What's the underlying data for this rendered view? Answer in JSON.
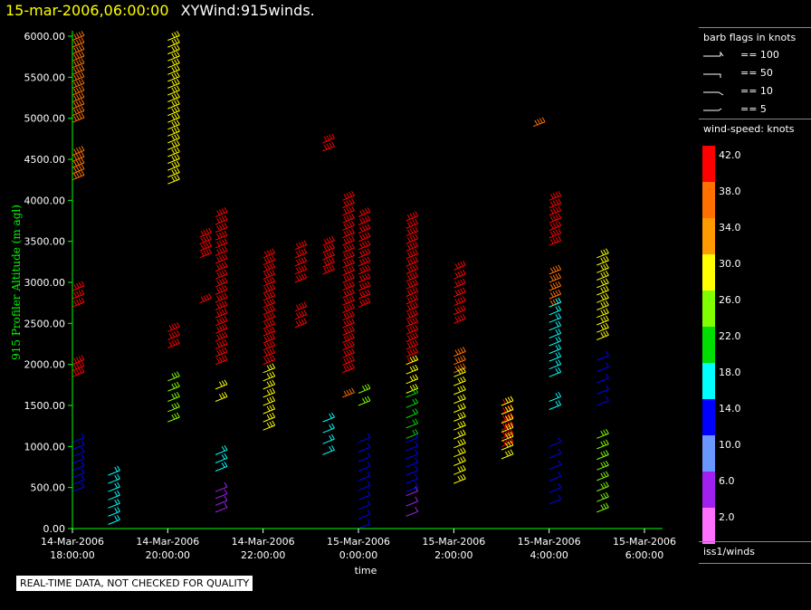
{
  "header": {
    "date": "15-mar-2006,06:00:00",
    "title": "XYWind:915winds."
  },
  "legend": {
    "barb_title": "barb flags in knots",
    "barb_items": [
      "== 100",
      "== 50",
      "== 10",
      "== 5"
    ],
    "speed_title": "wind-speed: knots",
    "scale_labels": [
      "42.0",
      "38.0",
      "34.0",
      "30.0",
      "26.0",
      "22.0",
      "18.0",
      "14.0",
      "10.0",
      "6.0",
      "2.0"
    ],
    "scale_colors": [
      "#ff0000",
      "#ff7000",
      "#ff9a00",
      "#ffff00",
      "#80ff00",
      "#00dd00",
      "#00ffff",
      "#0000ff",
      "#6a96ff",
      "#a020f0",
      "#ff70ff"
    ],
    "source": "iss1/winds"
  },
  "disclaimer": "REAL-TIME DATA, NOT CHECKED FOR QUALITY",
  "colors": {
    "axis": "#00ff00",
    "ylabel": "#00ff00",
    "text": "#ffffff",
    "background": "#000000"
  },
  "chart_data": {
    "type": "scatter",
    "title": "XYWind:915winds.",
    "xlabel": "time",
    "ylabel": "915 Profiler Altitude (m agl)",
    "ylim": [
      0,
      6000
    ],
    "xlim_hours": [
      18,
      30
    ],
    "yticks": [
      "0.00",
      "500.00",
      "1000.00",
      "1500.00",
      "2000.00",
      "2500.00",
      "3000.00",
      "3500.00",
      "4000.00",
      "4500.00",
      "5000.00",
      "5500.00",
      "6000.00"
    ],
    "xticks": [
      {
        "date": "14-Mar-2006",
        "time": "18:00:00"
      },
      {
        "date": "14-Mar-2006",
        "time": "20:00:00"
      },
      {
        "date": "14-Mar-2006",
        "time": "22:00:00"
      },
      {
        "date": "15-Mar-2006",
        "time": "0:00:00"
      },
      {
        "date": "15-Mar-2006",
        "time": "2:00:00"
      },
      {
        "date": "15-Mar-2006",
        "time": "4:00:00"
      },
      {
        "date": "15-Mar-2006",
        "time": "6:00:00"
      }
    ],
    "profiles": [
      {
        "time": "14-Mar-2006 18:00",
        "segments": [
          {
            "from": 4950,
            "to": 5950,
            "n": 13,
            "speed": 36
          },
          {
            "from": 4250,
            "to": 4550,
            "n": 5,
            "speed": 36
          },
          {
            "from": 2700,
            "to": 2900,
            "n": 3,
            "speed": 42
          },
          {
            "from": 1850,
            "to": 2000,
            "n": 3,
            "speed": 42
          },
          {
            "from": 450,
            "to": 1050,
            "n": 8,
            "speed": 14
          }
        ]
      },
      {
        "time": "14-Mar-2006 18:45",
        "segments": [
          {
            "from": 50,
            "to": 650,
            "n": 7,
            "speed": 16
          }
        ]
      },
      {
        "time": "14-Mar-2006 20:00",
        "segments": [
          {
            "from": 4200,
            "to": 5950,
            "n": 22,
            "speed": 30
          },
          {
            "from": 2200,
            "to": 2400,
            "n": 3,
            "speed": 42
          },
          {
            "from": 1300,
            "to": 1800,
            "n": 5,
            "speed": 26
          }
        ]
      },
      {
        "time": "14-Mar-2006 20:40",
        "segments": [
          {
            "from": 3300,
            "to": 3550,
            "n": 4,
            "speed": 42
          },
          {
            "from": 2750,
            "to": 2780,
            "n": 1,
            "speed": 42
          }
        ]
      },
      {
        "time": "14-Mar-2006 21:00",
        "segments": [
          {
            "from": 2000,
            "to": 3800,
            "n": 20,
            "speed": 42
          },
          {
            "from": 1550,
            "to": 1700,
            "n": 2,
            "speed": 30
          },
          {
            "from": 700,
            "to": 900,
            "n": 3,
            "speed": 18
          },
          {
            "from": 200,
            "to": 450,
            "n": 4,
            "speed": 6
          }
        ]
      },
      {
        "time": "14-Mar-2006 22:00",
        "segments": [
          {
            "from": 2000,
            "to": 3300,
            "n": 16,
            "speed": 42
          },
          {
            "from": 1200,
            "to": 1900,
            "n": 8,
            "speed": 30
          }
        ]
      },
      {
        "time": "14-Mar-2006 22:40",
        "segments": [
          {
            "from": 3000,
            "to": 3400,
            "n": 5,
            "speed": 42
          },
          {
            "from": 2450,
            "to": 2650,
            "n": 3,
            "speed": 42
          }
        ]
      },
      {
        "time": "14-Mar-2006 23:15",
        "segments": [
          {
            "from": 3100,
            "to": 3450,
            "n": 5,
            "speed": 42
          },
          {
            "from": 4600,
            "to": 4700,
            "n": 2,
            "speed": 42
          },
          {
            "from": 900,
            "to": 1300,
            "n": 4,
            "speed": 18
          }
        ]
      },
      {
        "time": "14-Mar-2006 23:40",
        "segments": [
          {
            "from": 1900,
            "to": 4000,
            "n": 24,
            "speed": 42
          },
          {
            "from": 1600,
            "to": 1650,
            "n": 1,
            "speed": 36
          }
        ]
      },
      {
        "time": "15-Mar-2006 0:00",
        "segments": [
          {
            "from": 2700,
            "to": 3800,
            "n": 12,
            "speed": 42
          },
          {
            "from": 1500,
            "to": 1650,
            "n": 2,
            "speed": 26
          },
          {
            "from": 0,
            "to": 1050,
            "n": 10,
            "speed": 14
          }
        ]
      },
      {
        "time": "15-Mar-2006 1:00",
        "segments": [
          {
            "from": 2000,
            "to": 3750,
            "n": 20,
            "speed": 42
          },
          {
            "from": 1650,
            "to": 2000,
            "n": 4,
            "speed": 30
          },
          {
            "from": 1100,
            "to": 1600,
            "n": 5,
            "speed": 22
          },
          {
            "from": 450,
            "to": 1050,
            "n": 7,
            "speed": 14
          },
          {
            "from": 150,
            "to": 400,
            "n": 3,
            "speed": 6
          }
        ]
      },
      {
        "time": "15-Mar-2006 2:00",
        "segments": [
          {
            "from": 2500,
            "to": 3150,
            "n": 7,
            "speed": 42
          },
          {
            "from": 1900,
            "to": 2100,
            "n": 3,
            "speed": 36
          },
          {
            "from": 550,
            "to": 1850,
            "n": 13,
            "speed": 30
          }
        ]
      },
      {
        "time": "15-Mar-2006 3:00",
        "segments": [
          {
            "from": 1000,
            "to": 1500,
            "n": 6,
            "speed": 42
          },
          {
            "from": 850,
            "to": 1500,
            "n": 7,
            "speed": 28
          }
        ]
      },
      {
        "time": "15-Mar-2006 3:40",
        "segments": [
          {
            "from": 4900,
            "to": 4970,
            "n": 1,
            "speed": 38
          }
        ]
      },
      {
        "time": "15-Mar-2006 4:00",
        "segments": [
          {
            "from": 3450,
            "to": 4000,
            "n": 7,
            "speed": 42
          },
          {
            "from": 2700,
            "to": 3100,
            "n": 5,
            "speed": 38
          },
          {
            "from": 1850,
            "to": 2700,
            "n": 10,
            "speed": 18
          },
          {
            "from": 1450,
            "to": 1550,
            "n": 2,
            "speed": 18
          },
          {
            "from": 300,
            "to": 1000,
            "n": 6,
            "speed": 14
          }
        ]
      },
      {
        "time": "15-Mar-2006 5:00",
        "segments": [
          {
            "from": 2300,
            "to": 3300,
            "n": 12,
            "speed": 30
          },
          {
            "from": 1500,
            "to": 2050,
            "n": 5,
            "speed": 14
          },
          {
            "from": 200,
            "to": 1100,
            "n": 8,
            "speed": 26
          }
        ]
      }
    ]
  }
}
